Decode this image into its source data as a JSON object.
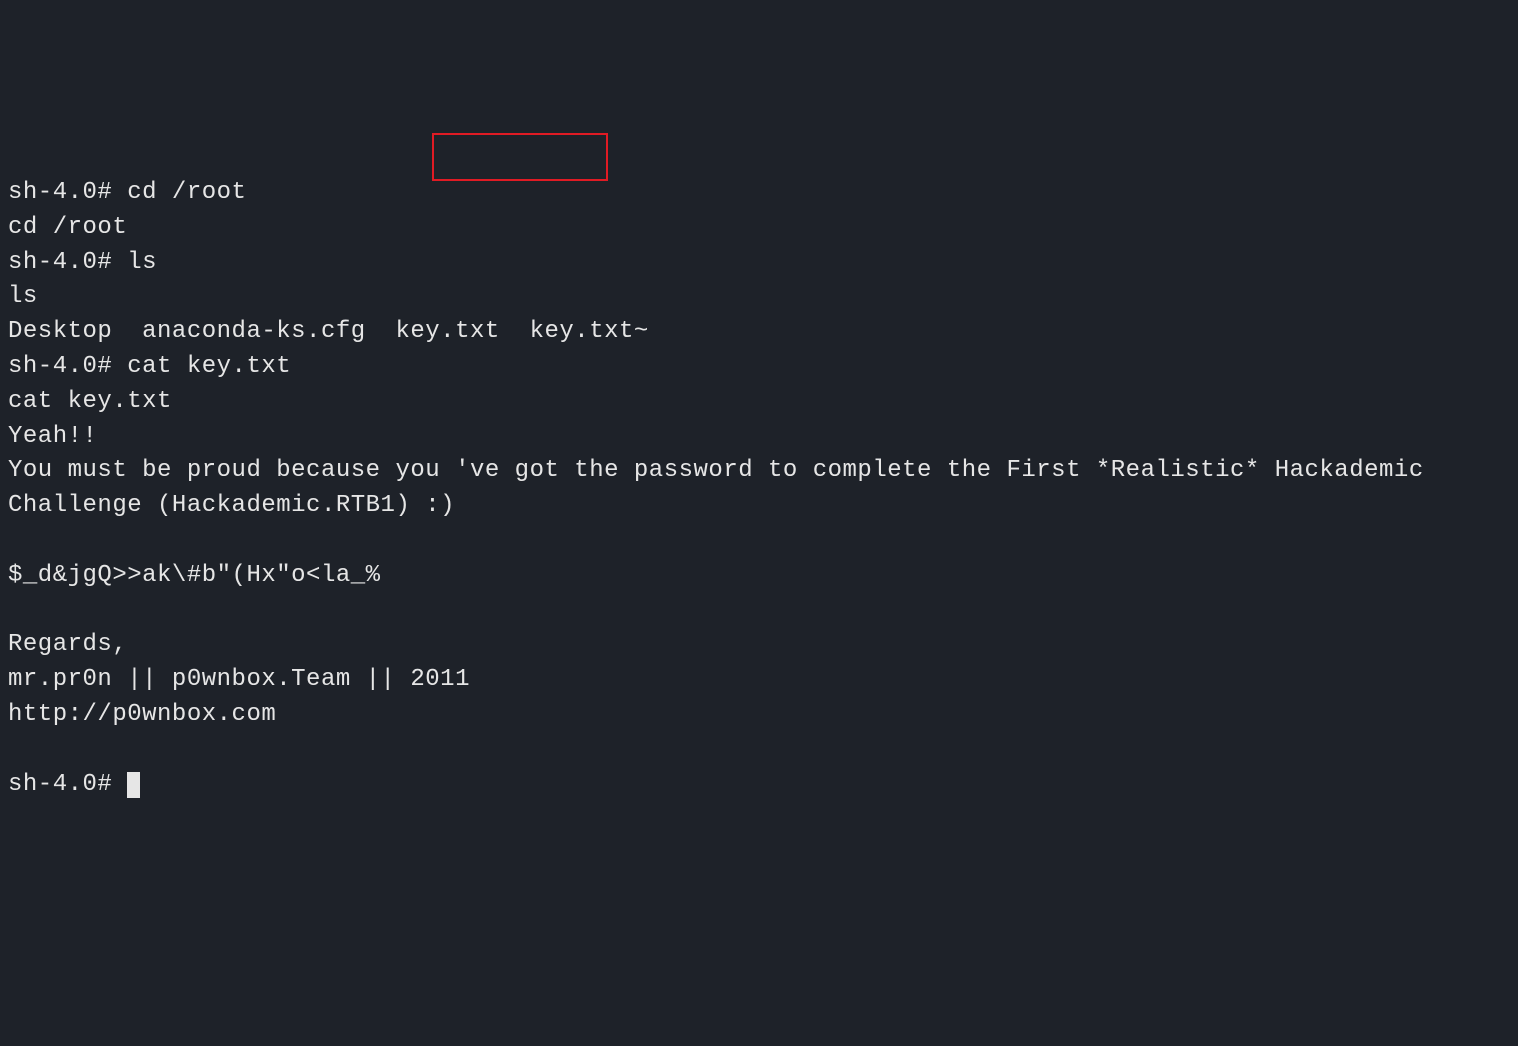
{
  "terminal": {
    "lines": [
      "sh-4.0# cd /root",
      "cd /root",
      "sh-4.0# ls",
      "ls",
      "Desktop  anaconda-ks.cfg  key.txt  key.txt~",
      "sh-4.0# cat key.txt",
      "cat key.txt",
      "Yeah!!",
      "You must be proud because you 've got the password to complete the First *Realistic* Hackademic Challenge (Hackademic.RTB1) :)",
      "",
      "$_d&jgQ>>ak\\#b\"(Hx\"o<la_%",
      "",
      "Regards,",
      "mr.pr0n || p0wnbox.Team || 2011",
      "http://p0wnbox.com",
      "",
      "sh-4.0# "
    ],
    "prompt": "sh-4.0# ",
    "highlighted_file": "key.txt"
  }
}
